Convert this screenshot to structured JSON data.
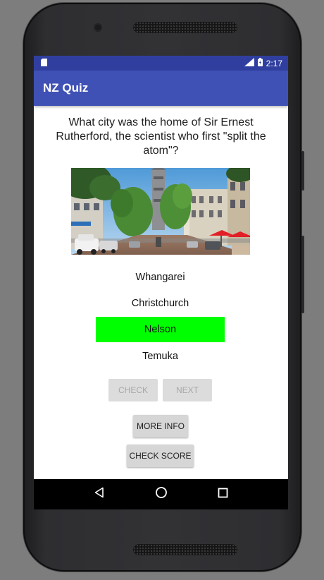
{
  "status_bar": {
    "time": "2:17",
    "icons": [
      "sd-card-icon",
      "signal-icon",
      "battery-icon"
    ]
  },
  "app": {
    "title": "NZ Quiz",
    "accent": "#3f51b5",
    "status_color": "#303f9f"
  },
  "quiz": {
    "question": "What city was the home of Sir Ernest Rutherford, the scientist who first \"split the atom\"?",
    "options": [
      {
        "label": "Whangarei",
        "selected": false
      },
      {
        "label": "Christchurch",
        "selected": false
      },
      {
        "label": "Nelson",
        "selected": true
      },
      {
        "label": "Temuka",
        "selected": false
      }
    ],
    "selected_color": "#00ff00"
  },
  "buttons": {
    "check": "CHECK",
    "next": "NEXT",
    "more_info": "MORE INFO",
    "check_score": "CHECK SCORE"
  },
  "nav": [
    "back-icon",
    "home-icon",
    "recents-icon"
  ]
}
